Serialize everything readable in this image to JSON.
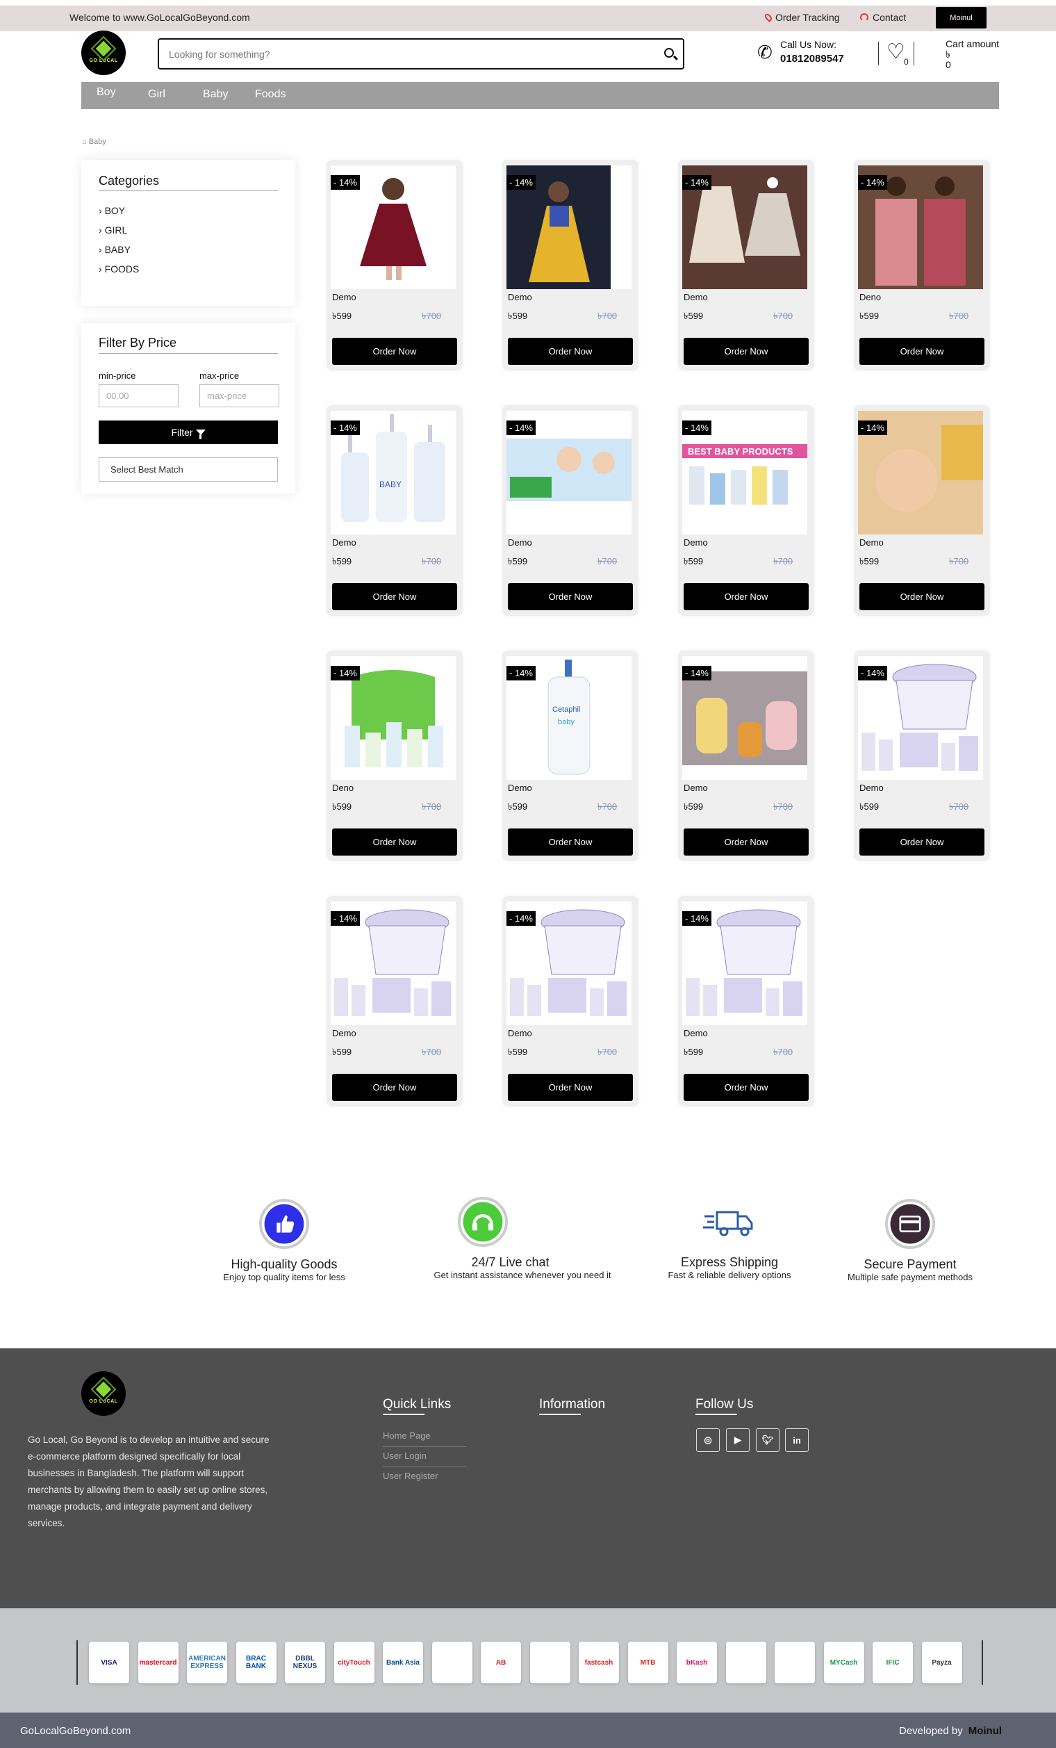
{
  "topbar": {
    "welcome": "Welcome to www.GoLocalGoBeyond.com",
    "order_tracking": "Order Tracking",
    "contact": "Contact",
    "user": "Moinul"
  },
  "header": {
    "logo_text": "GO LOCAL",
    "search_placeholder": "Looking for something?",
    "call_label": "Call Us Now:",
    "phone": "01812089547",
    "wishlist_count": "0",
    "cart_label": "Cart amount",
    "cart_currency": "৳",
    "cart_amount": "0"
  },
  "nav": [
    "Boy",
    "Girl",
    "Baby",
    "Foods"
  ],
  "breadcrumb": "Baby",
  "categories": {
    "title": "Categories",
    "items": [
      "BOY",
      "GIRL",
      "BABY",
      "FOODS"
    ]
  },
  "filter": {
    "title": "Filter By Price",
    "min_label": "min-price",
    "max_label": "max-price",
    "min_placeholder": "00.00",
    "max_placeholder": "max-price",
    "button": "Filter",
    "select": "Select Best Match"
  },
  "products": [
    {
      "name": "Demo",
      "discount": "- 14%",
      "price": "৳599",
      "old_price": "৳700",
      "button": "Order Now",
      "img": "red-dress"
    },
    {
      "name": "Demo",
      "discount": "- 14%",
      "price": "৳599",
      "old_price": "৳700",
      "button": "Order Now",
      "img": "yellow-dress"
    },
    {
      "name": "Demo",
      "discount": "- 14%",
      "price": "৳599",
      "old_price": "৳700",
      "button": "Order Now",
      "img": "sketch-dresses"
    },
    {
      "name": "Deno",
      "discount": "- 14%",
      "price": "৳599",
      "old_price": "৳700",
      "button": "Order Now",
      "img": "shawls"
    },
    {
      "name": "Demo",
      "discount": "- 14%",
      "price": "৳599",
      "old_price": "৳700",
      "button": "Order Now",
      "img": "baby-bottles"
    },
    {
      "name": "Demo",
      "discount": "- 14%",
      "price": "৳599",
      "old_price": "৳700",
      "button": "Order Now",
      "img": "baby-banner"
    },
    {
      "name": "Demo",
      "discount": "- 14%",
      "price": "৳599",
      "old_price": "৳700",
      "button": "Order Now",
      "img": "best-baby-products",
      "img_caption": "BEST BABY PRODUCTS"
    },
    {
      "name": "Demo",
      "discount": "- 14%",
      "price": "৳599",
      "old_price": "৳700",
      "button": "Order Now",
      "img": "baby-face"
    },
    {
      "name": "Deno",
      "discount": "- 14%",
      "price": "৳599",
      "old_price": "৳700",
      "button": "Order Now",
      "img": "green-bag"
    },
    {
      "name": "Demo",
      "discount": "- 14%",
      "price": "৳599",
      "old_price": "৳700",
      "button": "Order Now",
      "img": "cetaphil",
      "img_caption": "Cetaphil baby"
    },
    {
      "name": "Demo",
      "discount": "- 14%",
      "price": "৳599",
      "old_price": "৳700",
      "button": "Order Now",
      "img": "johnsons"
    },
    {
      "name": "Demo",
      "discount": "- 14%",
      "price": "৳599",
      "old_price": "৳700",
      "button": "Order Now",
      "img": "basket"
    },
    {
      "name": "Demo",
      "discount": "- 14%",
      "price": "৳599",
      "old_price": "৳700",
      "button": "Order Now",
      "img": "basket"
    },
    {
      "name": "Demo",
      "discount": "- 14%",
      "price": "৳599",
      "old_price": "৳700",
      "button": "Order Now",
      "img": "basket"
    },
    {
      "name": "Demo",
      "discount": "- 14%",
      "price": "৳599",
      "old_price": "৳700",
      "button": "Order Now",
      "img": "basket"
    }
  ],
  "features": [
    {
      "title": "High-quality Goods",
      "sub": "Enjoy top quality items for less",
      "icon": "thumbs-up-icon",
      "color": "#2f2fe8"
    },
    {
      "title": "24/7 Live chat",
      "sub": "Get instant assistance whenever you need it",
      "icon": "headset-icon",
      "color": "#4ccc3a"
    },
    {
      "title": "Express Shipping",
      "sub": "Fast & reliable delivery options",
      "icon": "truck-icon",
      "color": "#2b5ca8"
    },
    {
      "title": "Secure Payment",
      "sub": "Multiple safe payment methods",
      "icon": "credit-card-icon",
      "color": "#3a2a35"
    }
  ],
  "footer": {
    "about": "Go Local, Go Beyond is to develop an intuitive and secure e-commerce platform designed specifically for local businesses in Bangladesh. The platform will support merchants by allowing them to easily set up online stores, manage products, and integrate payment and delivery services.",
    "quick_links_title": "Quick Links",
    "quick_links": [
      "Home Page",
      "User Login",
      "User Register"
    ],
    "information_title": "Information",
    "follow_title": "Follow Us",
    "social": [
      "instagram-icon",
      "youtube-icon",
      "twitter-icon",
      "linkedin-icon"
    ]
  },
  "payments": [
    "VISA",
    "mastercard",
    "AMERICAN EXPRESS",
    "BRAC BANK",
    "DBBL NEXUS",
    "cityTouch",
    "Bank Asia",
    "",
    "AB",
    "",
    "fastcash",
    "MTB",
    "bKash",
    "",
    "",
    "MYCash",
    "IFIC",
    "Payza"
  ],
  "bottom": {
    "site": "GoLocalGoBeyond.com",
    "developed_by": "Developed by",
    "developer": "Moinul"
  }
}
